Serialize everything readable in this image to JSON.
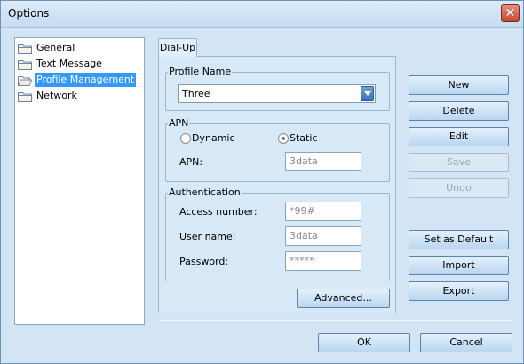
{
  "window": {
    "title": "Options",
    "close_symbol": "✕"
  },
  "tree": {
    "items": [
      {
        "label": "General",
        "icon": "folder-icon"
      },
      {
        "label": "Text Message",
        "icon": "folder-icon"
      },
      {
        "label": "Profile Management",
        "icon": "folder-open-icon",
        "selected": true
      },
      {
        "label": "Network",
        "icon": "folder-icon"
      }
    ]
  },
  "tab": {
    "label": "Dial-Up"
  },
  "profile": {
    "group_label": "Profile Name",
    "selected": "Three"
  },
  "apn": {
    "group_label": "APN",
    "dynamic_label": "Dynamic",
    "static_label": "Static",
    "selected_mode": "Static",
    "apn_label": "APN:",
    "apn_value": "3data"
  },
  "auth": {
    "group_label": "Authentication",
    "access_label": "Access number:",
    "access_value": "*99#",
    "user_label": "User name:",
    "user_value": "3data",
    "password_label": "Password:",
    "password_value": "*****"
  },
  "buttons": {
    "advanced": "Advanced...",
    "new": "New",
    "delete": "Delete",
    "edit": "Edit",
    "save": "Save",
    "undo": "Undo",
    "set_default": "Set as Default",
    "import": "Import",
    "export": "Export",
    "ok": "OK",
    "cancel": "Cancel"
  },
  "colors": {
    "selection": "#3399ff",
    "close_button": "#c6452f"
  }
}
